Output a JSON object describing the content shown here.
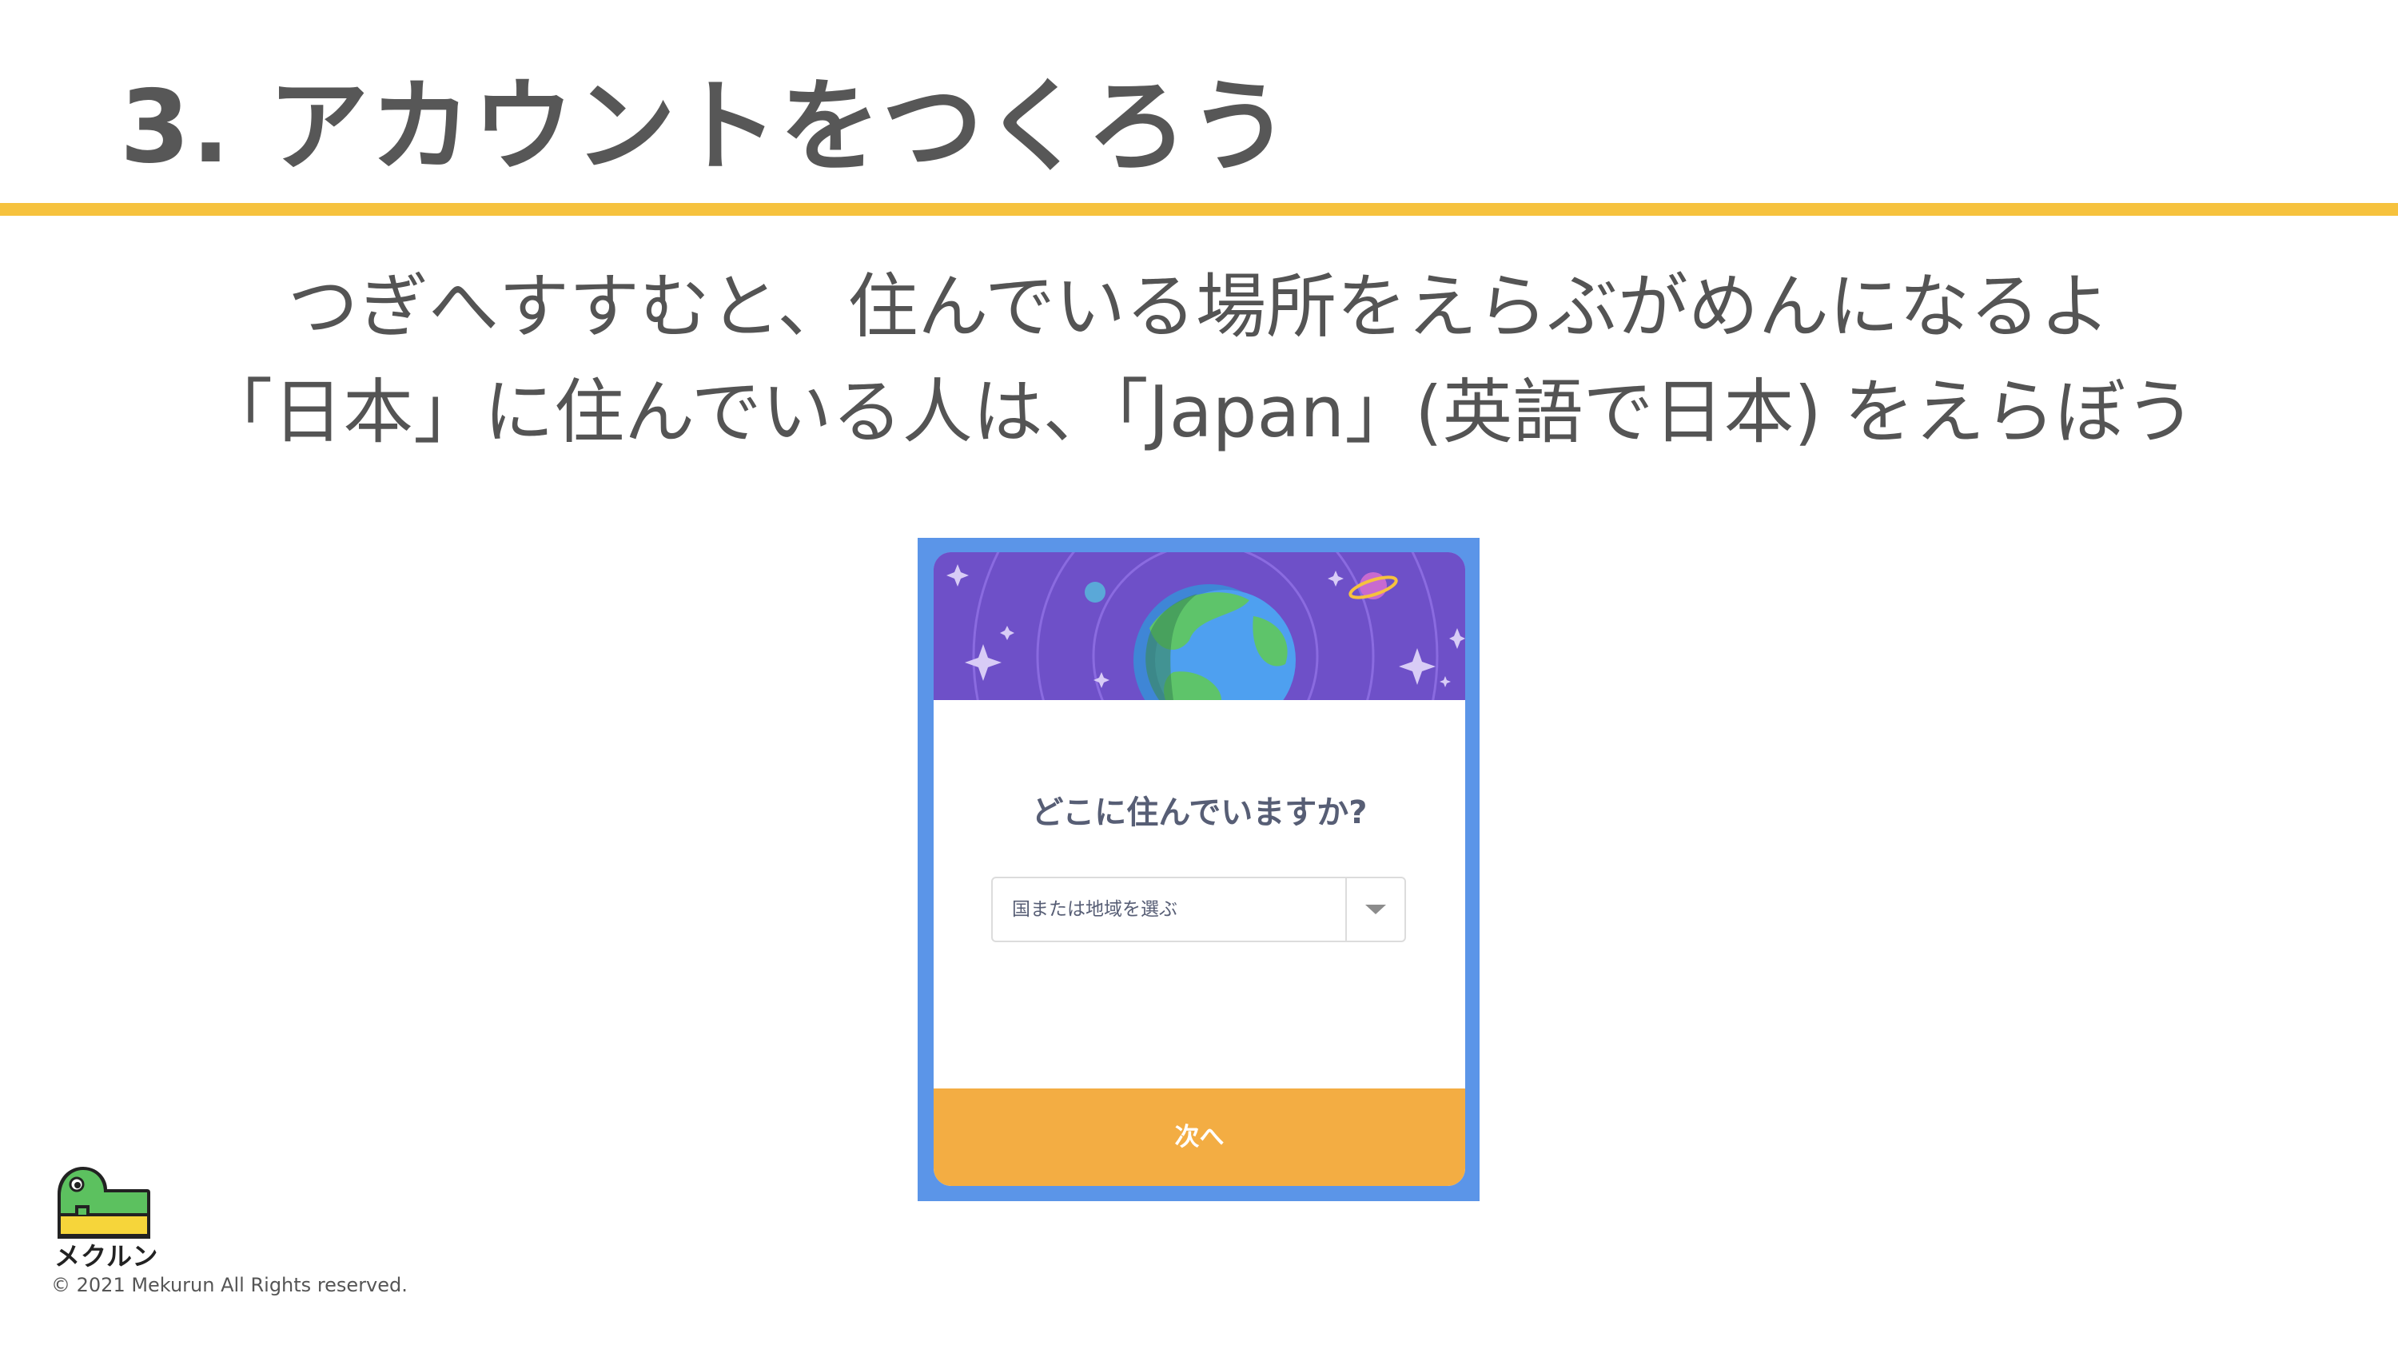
{
  "slide": {
    "title": "3. アカウントをつくろう",
    "instruction_line1": "つぎへすすむと、住んでいる場所をえらぶがめんになるよ",
    "instruction_line2": "「日本」に住んでいる人は、「Japan」(英語で日本) をえらぼう"
  },
  "dialog": {
    "question": "どこに住んでいますか?",
    "country_select": {
      "value": "国または地域を選ぶ",
      "icon": "caret-down-icon"
    },
    "next_label": "次へ",
    "banner_icons": [
      "earth-icon",
      "planet-icon",
      "sparkle-icon",
      "moon-icon"
    ]
  },
  "branding": {
    "logo_text": "メクルン",
    "copyright": "© 2021 Mekurun All Rights reserved.",
    "logo_icon": "mekurun-dinosaur-logo-icon"
  },
  "colors": {
    "accent_rule": "#f6c23e",
    "dialog_frame": "#5b95e8",
    "banner": "#6e50c8",
    "next_button": "#f3ad43",
    "text": "#575e75"
  }
}
